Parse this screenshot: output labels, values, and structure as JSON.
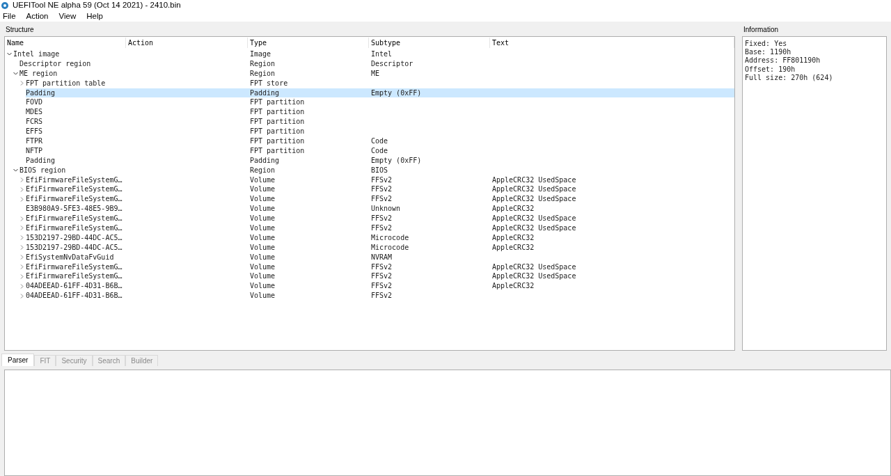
{
  "window": {
    "title": "UEFITool NE alpha 59 (Oct 14 2021) - 2410.bin"
  },
  "menu": [
    "File",
    "Action",
    "View",
    "Help"
  ],
  "structure": {
    "title": "Structure",
    "columns": [
      "Name",
      "Action",
      "Type",
      "Subtype",
      "Text"
    ],
    "rows": [
      {
        "name": "Intel image",
        "type": "Image",
        "subtype": "Intel",
        "selected": false,
        "expanded": true,
        "children": [
          {
            "name": "Descriptor region",
            "type": "Region",
            "subtype": "Descriptor",
            "selected": false
          },
          {
            "name": "ME region",
            "type": "Region",
            "subtype": "ME",
            "selected": false,
            "expanded": true,
            "children": [
              {
                "name": "FPT partition table",
                "type": "FPT store",
                "selected": false,
                "expanded": false
              },
              {
                "name": "Padding",
                "type": "Padding",
                "subtype": "Empty (0xFF)",
                "selected": true
              },
              {
                "name": "FOVD",
                "type": "FPT partition",
                "selected": false
              },
              {
                "name": "MDES",
                "type": "FPT partition",
                "selected": false
              },
              {
                "name": "FCRS",
                "type": "FPT partition",
                "selected": false
              },
              {
                "name": "EFFS",
                "type": "FPT partition",
                "selected": false
              },
              {
                "name": "FTPR",
                "type": "FPT partition",
                "subtype": "Code",
                "selected": false
              },
              {
                "name": "NFTP",
                "type": "FPT partition",
                "subtype": "Code",
                "selected": false
              },
              {
                "name": "Padding",
                "type": "Padding",
                "subtype": "Empty (0xFF)",
                "selected": false
              }
            ]
          },
          {
            "name": "BIOS region",
            "type": "Region",
            "subtype": "BIOS",
            "selected": false,
            "expanded": true,
            "children": [
              {
                "name": "EfiFirmwareFileSystemG…",
                "type": "Volume",
                "subtype": "FFSv2",
                "text": "AppleCRC32 UsedSpace",
                "selected": false,
                "expanded": false
              },
              {
                "name": "EfiFirmwareFileSystemG…",
                "type": "Volume",
                "subtype": "FFSv2",
                "text": "AppleCRC32 UsedSpace",
                "selected": false,
                "expanded": false
              },
              {
                "name": "EfiFirmwareFileSystemG…",
                "type": "Volume",
                "subtype": "FFSv2",
                "text": "AppleCRC32 UsedSpace",
                "selected": false,
                "expanded": false
              },
              {
                "name": "E3B980A9-5FE3-48E5-9B9…",
                "type": "Volume",
                "subtype": "Unknown",
                "text": "AppleCRC32",
                "selected": false
              },
              {
                "name": "EfiFirmwareFileSystemG…",
                "type": "Volume",
                "subtype": "FFSv2",
                "text": "AppleCRC32 UsedSpace",
                "selected": false,
                "expanded": false
              },
              {
                "name": "EfiFirmwareFileSystemG…",
                "type": "Volume",
                "subtype": "FFSv2",
                "text": "AppleCRC32 UsedSpace",
                "selected": false,
                "expanded": false
              },
              {
                "name": "153D2197-29BD-44DC-AC5…",
                "type": "Volume",
                "subtype": "Microcode",
                "text": "AppleCRC32",
                "selected": false,
                "expanded": false
              },
              {
                "name": "153D2197-29BD-44DC-AC5…",
                "type": "Volume",
                "subtype": "Microcode",
                "text": "AppleCRC32",
                "selected": false,
                "expanded": false
              },
              {
                "name": "EfiSystemNvDataFvGuid",
                "type": "Volume",
                "subtype": "NVRAM",
                "selected": false,
                "expanded": false
              },
              {
                "name": "EfiFirmwareFileSystemG…",
                "type": "Volume",
                "subtype": "FFSv2",
                "text": "AppleCRC32 UsedSpace",
                "selected": false,
                "expanded": false
              },
              {
                "name": "EfiFirmwareFileSystemG…",
                "type": "Volume",
                "subtype": "FFSv2",
                "text": "AppleCRC32 UsedSpace",
                "selected": false,
                "expanded": false
              },
              {
                "name": "04ADEEAD-61FF-4D31-B6B…",
                "type": "Volume",
                "subtype": "FFSv2",
                "text": "AppleCRC32",
                "selected": false,
                "expanded": false
              },
              {
                "name": "04ADEEAD-61FF-4D31-B6B…",
                "type": "Volume",
                "subtype": "FFSv2",
                "selected": false,
                "expanded": false
              }
            ]
          }
        ]
      }
    ]
  },
  "information": {
    "title": "Information",
    "lines": [
      "Fixed: Yes",
      "Base: 1190h",
      "Address: FF801190h",
      "Offset: 190h",
      "Full size: 270h (624)"
    ]
  },
  "tabs": [
    {
      "label": "Parser",
      "selected": true
    },
    {
      "label": "FIT",
      "selected": false
    },
    {
      "label": "Security",
      "selected": false
    },
    {
      "label": "Search",
      "selected": false
    },
    {
      "label": "Builder",
      "selected": false
    }
  ]
}
